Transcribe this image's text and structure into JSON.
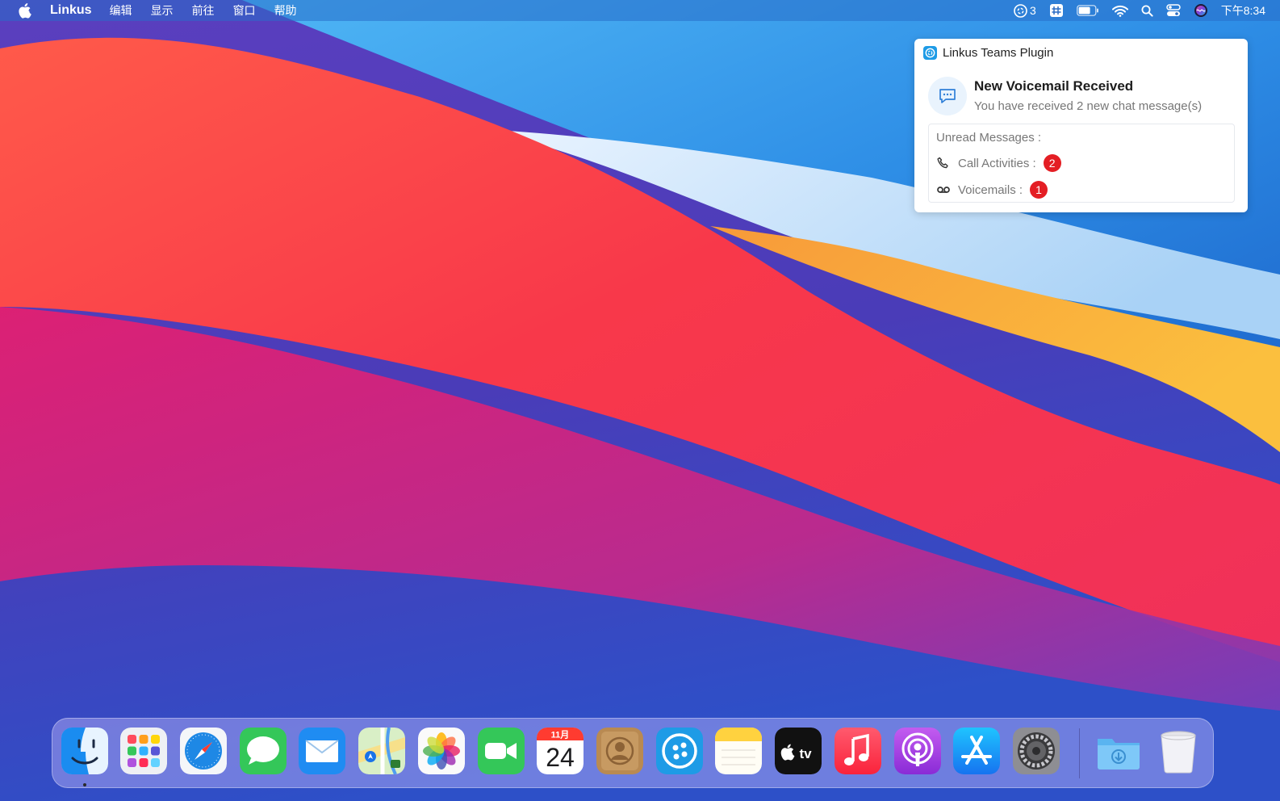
{
  "menubar": {
    "apple_icon": "apple-logo",
    "app_name": "Linkus",
    "menus": [
      "编辑",
      "显示",
      "前往",
      "窗口",
      "帮助"
    ],
    "status": {
      "linkus_count": "3",
      "time": "下午8:34"
    }
  },
  "notification": {
    "app": "Linkus Teams Plugin",
    "title": "New Voicemail Received",
    "subtitle": "You have received 2 new chat message(s)",
    "unread_label": "Unread Messages :",
    "rows": [
      {
        "icon": "phone-icon",
        "label": "Call Activities :",
        "count": "2"
      },
      {
        "icon": "voicemail-icon",
        "label": "Voicemails :",
        "count": "1"
      }
    ]
  },
  "dock": {
    "calendar": {
      "month": "11月",
      "day": "24"
    },
    "apps": [
      "finder",
      "launchpad",
      "safari",
      "messages",
      "mail",
      "maps",
      "photos",
      "facetime",
      "calendar",
      "contacts",
      "linkus",
      "notes",
      "apple-tv",
      "music",
      "podcasts",
      "app-store",
      "system-preferences",
      "downloads",
      "trash"
    ]
  },
  "colors": {
    "badge": "#e41e24",
    "linkus_blue": "#1e9be6",
    "menubar": "#2a6cc4"
  }
}
